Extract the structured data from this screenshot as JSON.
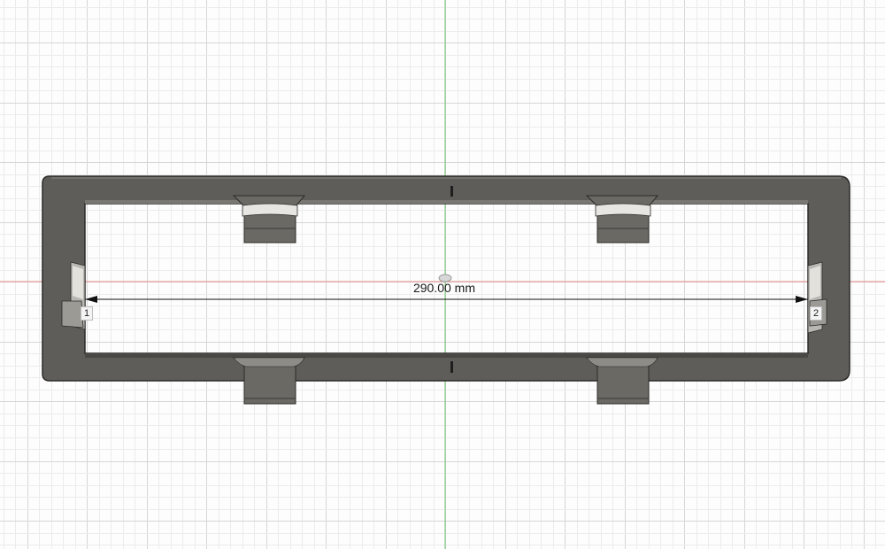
{
  "canvas": {
    "background": "#fdfdfd",
    "grid_minor_color": "#ececec",
    "grid_major_color": "#d6d6d6",
    "x_axis_color": "#e88a8a",
    "y_axis_color": "#6cc46c"
  },
  "part": {
    "body_color": "#5f5d59",
    "body_edge_color": "#2c2b29",
    "highlight_color": "#e8e6e2",
    "tab_color": "#6b6964"
  },
  "dimension": {
    "label": "290.00 mm",
    "line_color": "#111111"
  },
  "points": {
    "start_label": "1",
    "end_label": "2"
  }
}
